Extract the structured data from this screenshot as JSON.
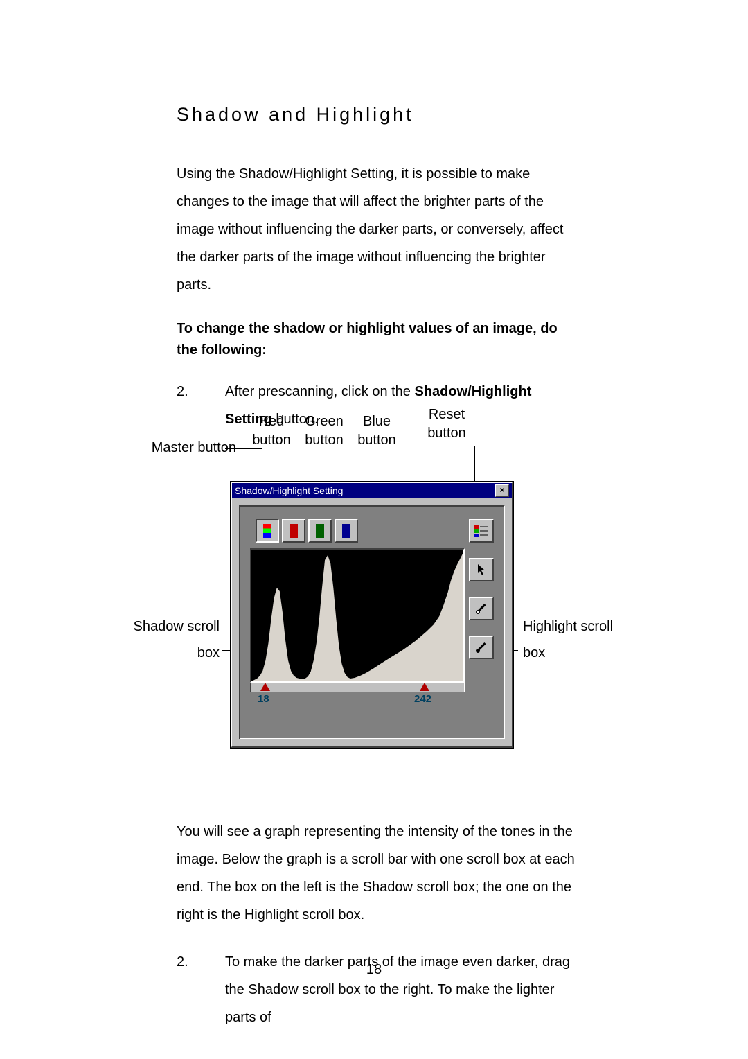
{
  "section_title": "Shadow and Highlight",
  "intro": "Using the Shadow/Highlight Setting, it is possible to make changes to the image that will affect the brighter parts of the image without influencing the darker parts, or conversely, affect the darker parts of the image without influencing the brighter parts.",
  "lead": "To change the shadow or highlight values of an image, do the following:",
  "steps": {
    "a": {
      "num": "2.",
      "pre": "After prescanning, click on the ",
      "bold": "Shadow/Highlight Setting",
      "post": " button."
    },
    "b": {
      "num": "2.",
      "text": "To make the darker parts of the image even darker, drag the Shadow scroll box to the right.  To make the lighter parts of"
    }
  },
  "mid_para": "You will see a graph representing the intensity of the tones in  the image.  Below the graph is a scroll bar with one scroll box at each end.  The box on the left is the Shadow scroll box; the one on the right is the Highlight scroll box.",
  "callouts": {
    "master": "Master button",
    "red": "Red button",
    "green": "Green button",
    "blue": "Blue button",
    "reset": "Reset button",
    "shadow": "Shadow scroll box",
    "highlight": "Highlight scroll box"
  },
  "dialog": {
    "title": "Shadow/Highlight Setting",
    "close": "×",
    "shadow_value": "18",
    "highlight_value": "242"
  },
  "page_number": "18"
}
